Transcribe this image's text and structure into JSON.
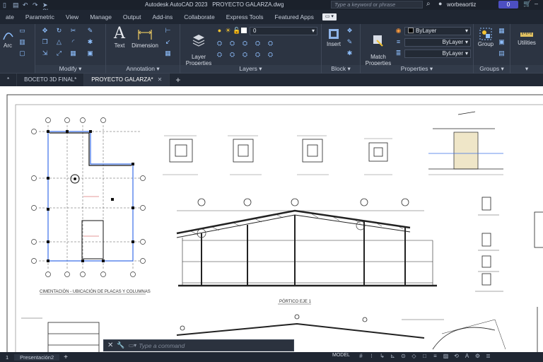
{
  "titlebar": {
    "share_label": "Share",
    "app_title": "Autodesk AutoCAD 2023",
    "file_name": "PROYECTO GALARZA.dwg",
    "search_placeholder": "Type a keyword or phrase",
    "user_name": "worbeaortiz",
    "account_badge": "0"
  },
  "menubar": {
    "tabs": [
      "ate",
      "Parametric",
      "View",
      "Manage",
      "Output",
      "Add-ins",
      "Collaborate",
      "Express Tools",
      "Featured Apps"
    ]
  },
  "ribbon": {
    "draw": {
      "arc_label": "Arc"
    },
    "modify": {
      "title": "Modify"
    },
    "annotation": {
      "title": "Annotation",
      "text_label": "Text",
      "dimension_label": "Dimension"
    },
    "layers": {
      "title": "Layers",
      "layer_properties_label": "Layer\nProperties",
      "current_layer": "0"
    },
    "block": {
      "title": "Block",
      "insert_label": "Insert"
    },
    "properties": {
      "title": "Properties",
      "match_label": "Match\nProperties",
      "color": "ByLayer",
      "linetype": "ByLayer",
      "lineweight": "ByLayer"
    },
    "groups": {
      "title": "Groups",
      "group_label": "Group"
    },
    "utilities": {
      "label": "Utilities"
    }
  },
  "doctabs": {
    "tabs": [
      {
        "label": "*"
      },
      {
        "label": "BOCETO 3D FINAL*"
      },
      {
        "label": "PROYECTO GALARZA*",
        "active": true
      }
    ]
  },
  "commandline": {
    "placeholder": "Type a command"
  },
  "statusbar": {
    "layout_tab": "Presentación2",
    "model_label": "MODEL"
  },
  "drawing": {
    "plan_caption": "CIMENTACIÓN - UBICACIÓN DE PLACAS Y COLUMNAS",
    "elevation_caption": "PÓRTICO EJE 1",
    "colors": {
      "axis": "#3a6fe8",
      "lines": "#333333",
      "background": "#ffffff"
    }
  }
}
